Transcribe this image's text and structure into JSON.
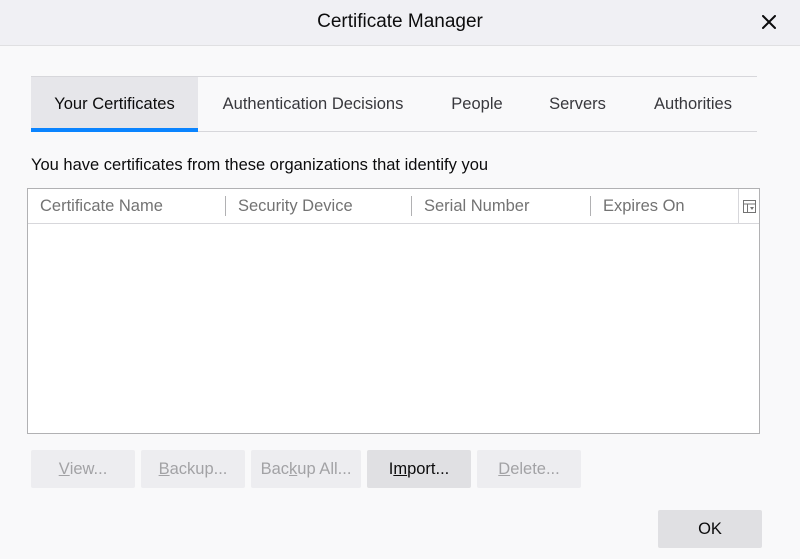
{
  "window": {
    "title": "Certificate Manager"
  },
  "tabs": [
    {
      "label": "Your Certificates",
      "selected": true
    },
    {
      "label": "Authentication Decisions",
      "selected": false
    },
    {
      "label": "People",
      "selected": false
    },
    {
      "label": "Servers",
      "selected": false
    },
    {
      "label": "Authorities",
      "selected": false
    }
  ],
  "description": "You have certificates from these organizations that identify you",
  "table": {
    "columns": [
      "Certificate Name",
      "Security Device",
      "Serial Number",
      "Expires On"
    ],
    "rows": []
  },
  "buttons": {
    "view": {
      "pre": "",
      "key": "V",
      "post": "iew...",
      "enabled": false
    },
    "backup": {
      "pre": "",
      "key": "B",
      "post": "ackup...",
      "enabled": false
    },
    "backup_all": {
      "pre": "Bac",
      "key": "k",
      "post": "up All...",
      "enabled": false
    },
    "import": {
      "pre": "I",
      "key": "m",
      "post": "port...",
      "enabled": true
    },
    "delete": {
      "pre": "",
      "key": "D",
      "post": "elete...",
      "enabled": false
    }
  },
  "ok_label": "OK",
  "colors": {
    "accent": "#0a84ff",
    "background": "#f9f9fa",
    "disabled_text": "#a2a2a5"
  },
  "icons": {
    "close": "close-icon",
    "column_picker": "column-picker-icon"
  }
}
